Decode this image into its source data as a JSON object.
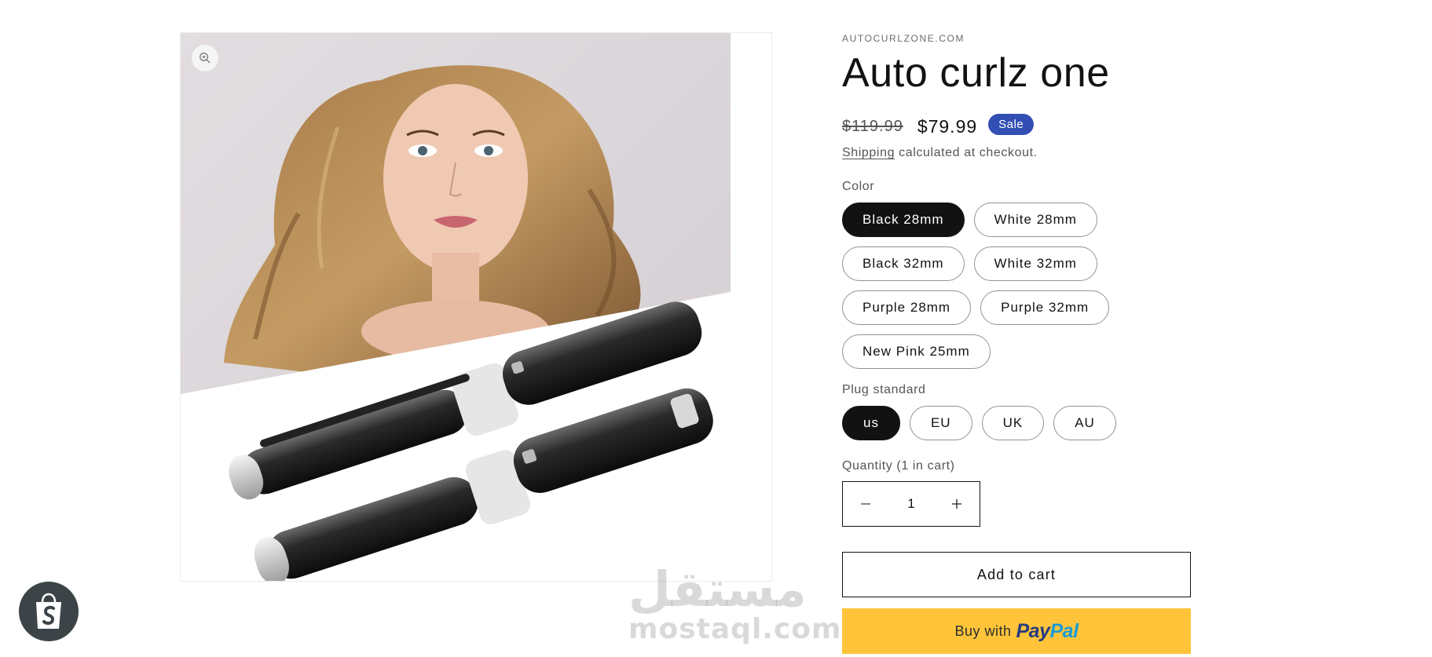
{
  "product": {
    "vendor": "AUTOCURLZONE.COM",
    "title": "Auto curlz one",
    "compare_price": "$119.99",
    "sale_price": "$79.99",
    "badge": "Sale",
    "shipping_link": "Shipping",
    "tax_note": " calculated at checkout."
  },
  "options": {
    "color": {
      "label": "Color",
      "values": [
        "Black 28mm",
        "White 28mm",
        "Black 32mm",
        "White 32mm",
        "Purple 28mm",
        "Purple 32mm",
        "New Pink 25mm"
      ],
      "selected": "Black 28mm"
    },
    "plug": {
      "label": "Plug standard",
      "values": [
        "us",
        "EU",
        "UK",
        "AU"
      ],
      "selected": "us"
    }
  },
  "quantity": {
    "label": "Quantity (1 in cart)",
    "value": "1",
    "decrease_icon": "minus-icon",
    "increase_icon": "plus-icon"
  },
  "buttons": {
    "add_to_cart": "Add to cart",
    "buy_with": "Buy with",
    "paypal_pay": "Pay",
    "paypal_pal": "Pal"
  },
  "watermark": {
    "arabic": "مستقل",
    "latin": "mostaql.com"
  },
  "icons": {
    "zoom": "zoom-in-icon",
    "shopify": "shopify-bag-icon"
  },
  "colors": {
    "sale_badge": "#334fb4",
    "selected_pill": "#121212",
    "paypal_button": "#ffc439",
    "paypal_blue_dark": "#253b80",
    "paypal_blue_light": "#179bd7",
    "shopify_badge": "#3c4447"
  }
}
